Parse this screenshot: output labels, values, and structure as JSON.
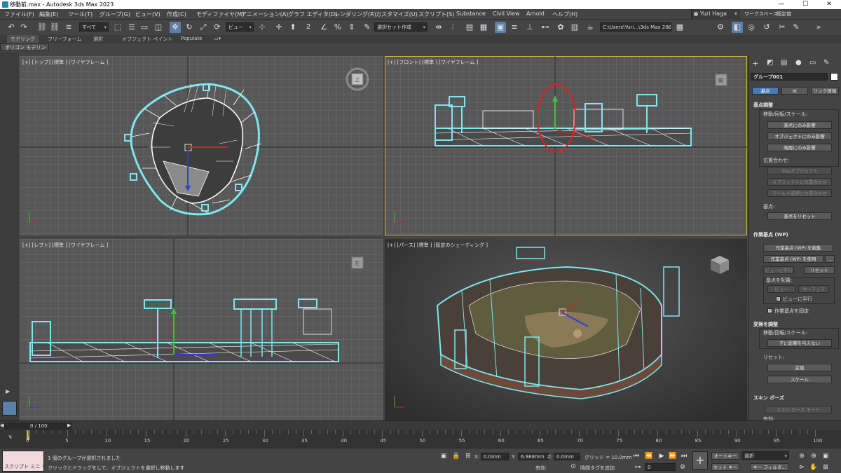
{
  "window": {
    "title": "移動前.max - Autodesk 3ds Max 2023",
    "minimize": "—",
    "maximize": "☐",
    "close": "✕"
  },
  "menu": [
    "ファイル(F)",
    "編集(E)",
    "ツール(T)",
    "グループ(G)",
    "ビュー(V)",
    "作成(C)",
    "モディファイヤ(M)",
    "アニメーション(A)",
    "グラフ エディタ(D)",
    "レンダリング(R)",
    "カスタマイズ(U)",
    "スクリプト(S)",
    "Substance",
    "Civil View",
    "Arnold",
    "ヘルプ(H)"
  ],
  "user": {
    "name": "Yuri Haga",
    "workspace_label": "ワークスペース:",
    "workspace_value": "既定値"
  },
  "toolbar": {
    "filter": "すべて",
    "refcoord": "ビュー",
    "selset": "選択セット作成",
    "path": "C:\\Users\\Yuri...\\3ds Max 2023"
  },
  "ribbon": {
    "tabs": [
      "モデリング",
      "フリーフォーム",
      "選択",
      "オブジェクト ペイント",
      "Populate"
    ],
    "subtab": "ポリゴン モデリング"
  },
  "viewports": {
    "top": {
      "label": "[+] [トップ] [標準 ] [ワイヤフレーム ]",
      "cube": "上"
    },
    "front": {
      "label": "[+] [フロント] [標準 ] [ワイヤフレーム ]",
      "cube": "前"
    },
    "left": {
      "label": "[+] [レフト] [標準 ] [ワイヤフレーム ]",
      "cube": "左"
    },
    "persp": {
      "label": "[+] [パース] [標準 ] [既定のシェーディング ]"
    }
  },
  "command_panel": {
    "object_name": "グループ001",
    "tabs": [
      "基点",
      "IK",
      "リンク情報"
    ],
    "pivot_section": "基点調整",
    "move_rotate_scale": "移動/回転/スケール:",
    "btn_pivot_only": "基点にのみ影響",
    "btn_object_only": "オブジェクトにのみ影響",
    "btn_hierarchy_only": "階層にのみ影響",
    "align_label": "位置合わせ:",
    "btn_center": "中心オブジェクト",
    "btn_align_object": "オブジェクトに位置合わせ",
    "btn_align_world": "ワールド座標に位置合わせ",
    "pivot_label": "基点:",
    "btn_reset_pivot": "基点をリセット",
    "wp_section": "作業基点 (WP)",
    "btn_edit_wp": "作業基点 (WP) を編集",
    "btn_use_wp": "作業基点 (WP) を使用",
    "btn_more": "...",
    "btn_align_view": "ビューに平行",
    "btn_reset": "リセット",
    "place_label": "基点を配置:",
    "btn_view": "ビュー",
    "btn_surface": "サーフェス",
    "chk_align_view": "ビューに平行",
    "chk_pin_wp": "作業基点を固定",
    "transform_section": "変換を調整",
    "transform_mrs": "移動/回転/スケール:",
    "btn_no_children": "子に影響を与えない",
    "reset_label": "リセット:",
    "btn_transform": "変換",
    "btn_scale": "スケール",
    "skin_section": "スキン ポーズ",
    "btn_skin_mode": "スキン ポーズ モード",
    "enable_label": "有効:"
  },
  "timeline": {
    "frame": "0 / 100",
    "ticks": [
      0,
      5,
      10,
      15,
      20,
      25,
      30,
      35,
      40,
      45,
      50,
      55,
      60,
      65,
      70,
      75,
      80,
      85,
      90,
      95,
      100
    ]
  },
  "status": {
    "script_mini": "スクリプト ミニ リス",
    "msg1": "1 個のグループが選択されました",
    "msg2": "クリックとドラッグをして、オブジェクトを選択し移動します",
    "x_label": "X:",
    "x_value": "0.0mm",
    "y_label": "Y:",
    "y_value": "6.988mm",
    "z_label": "Z:",
    "z_value": "0.0mm",
    "grid": "グリッド = 10.0mm",
    "enable": "有効:",
    "add_time_tag": "時間タグを追加",
    "frame_value": "0",
    "auto_key": "オートキー",
    "auto_key_sel": "選択",
    "set_key": "セット キー",
    "key_filter": "キー フィルタ..."
  }
}
